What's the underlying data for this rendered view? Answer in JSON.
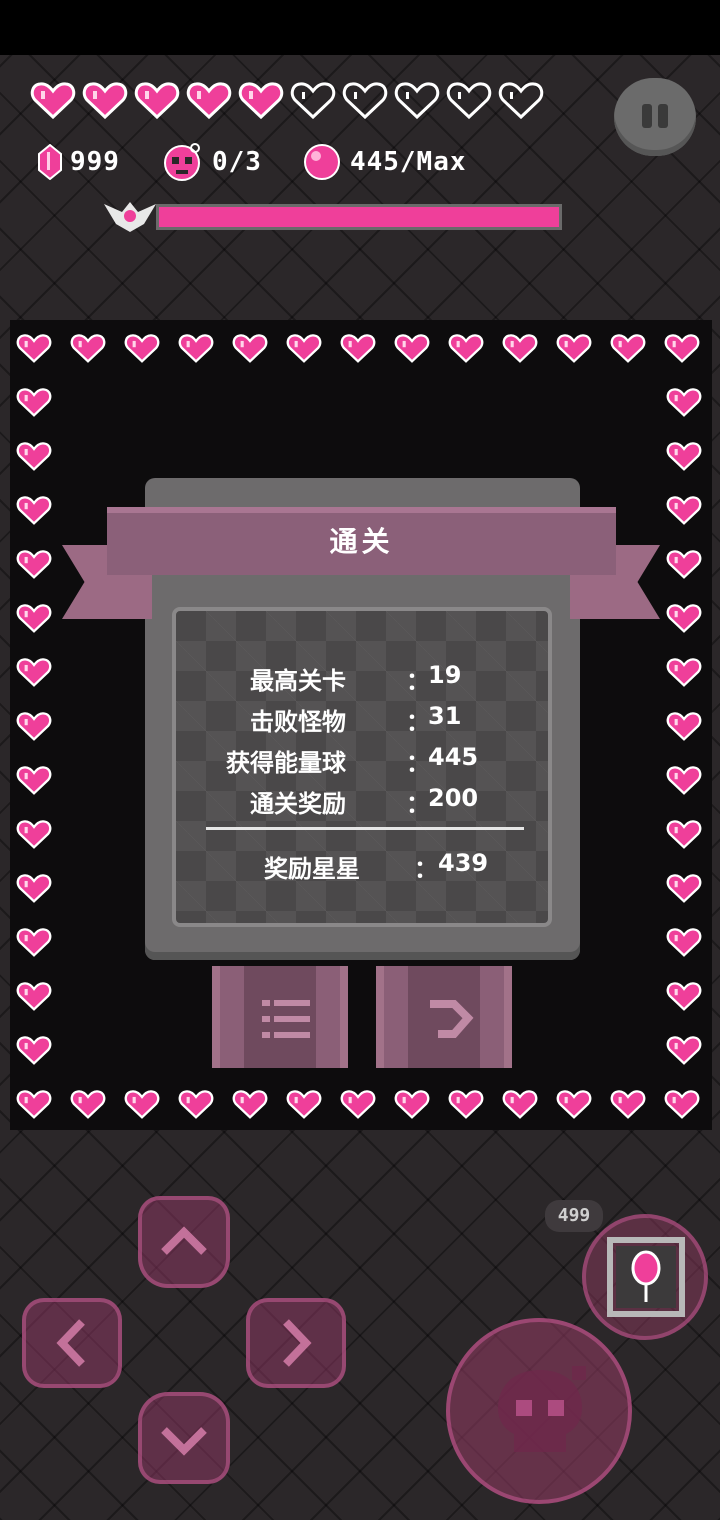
{
  "hud": {
    "hearts_filled": 5,
    "hearts_total": 10,
    "gems": "999",
    "skulls": "0/3",
    "orbs": "445/Max",
    "boss_progress": 1.0,
    "icons": [
      "heart-icon",
      "gem-icon",
      "skull-icon",
      "orb-icon",
      "boss-wing-icon",
      "pause-icon"
    ]
  },
  "dialog": {
    "title": "通关",
    "rows": [
      {
        "label": "最高关卡",
        "value": "19"
      },
      {
        "label": "击败怪物",
        "value": "31"
      },
      {
        "label": "获得能量球",
        "value": "445"
      },
      {
        "label": "通关奖励",
        "value": "200"
      }
    ],
    "total": {
      "label": "奖励星星",
      "value": "439"
    },
    "colon": "："
  },
  "buttons": {
    "menu_icon": "list-icon",
    "next_icon": "next-arrow-icon"
  },
  "controls": {
    "skill_count": "499",
    "icons": [
      "up-arrow-icon",
      "left-arrow-icon",
      "right-arrow-icon",
      "down-arrow-icon",
      "skull-attack-icon",
      "balloon-skill-icon"
    ]
  },
  "colors": {
    "accent": "#ef3f9a",
    "panel": "#6d6b6c",
    "banner": "#8b6079"
  }
}
